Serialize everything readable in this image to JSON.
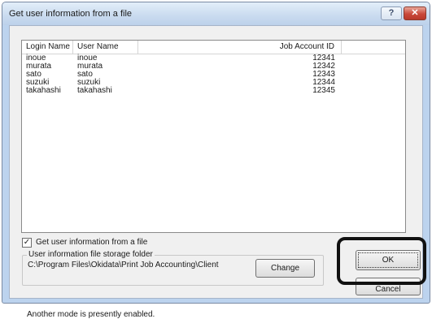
{
  "window": {
    "title": "Get user information from a file",
    "help_label": "?",
    "close_label": "✕"
  },
  "list": {
    "columns": [
      "Login Name",
      "User Name",
      "Job Account ID"
    ],
    "rows": [
      {
        "login": "inoue",
        "user": "inoue",
        "job_id": "12341"
      },
      {
        "login": "murata",
        "user": "murata",
        "job_id": "12342"
      },
      {
        "login": "sato",
        "user": "sato",
        "job_id": "12343"
      },
      {
        "login": "suzuki",
        "user": "suzuki",
        "job_id": "12344"
      },
      {
        "login": "takahashi",
        "user": "takahashi",
        "job_id": "12345"
      }
    ]
  },
  "checkbox": {
    "label": "Get user information from a file",
    "checked": true,
    "check_glyph": "✓"
  },
  "storage": {
    "group_title": "User information file storage folder",
    "path": "C:\\Program Files\\Okidata\\Print Job Accounting\\Client"
  },
  "buttons": {
    "change": "Change",
    "ok": "OK",
    "cancel": "Cancel"
  },
  "status": "Another mode is presently enabled.",
  "colors": {
    "title_bar": "#cbdcf0",
    "close_button": "#c9483a",
    "highlight_frame": "#111111"
  }
}
